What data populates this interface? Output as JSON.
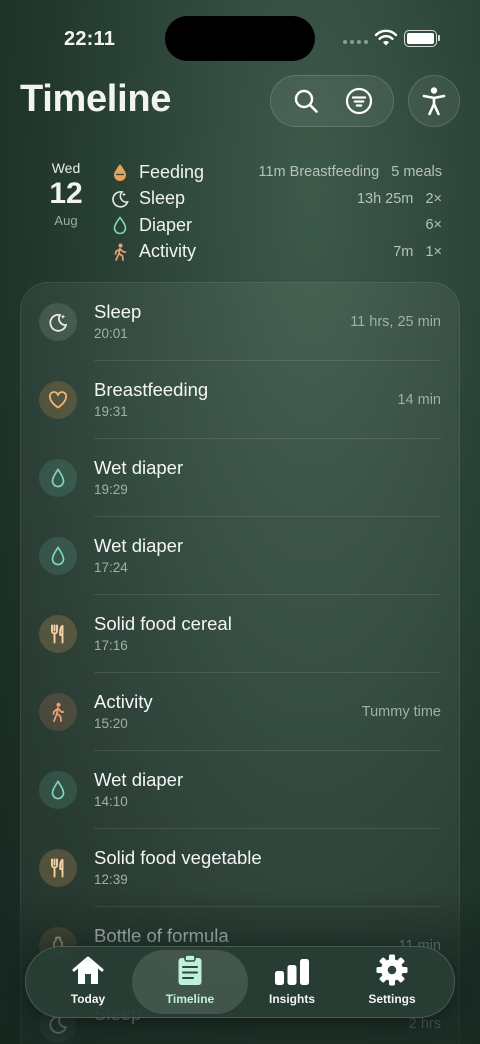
{
  "status_bar": {
    "time": "22:11"
  },
  "header": {
    "title": "Timeline"
  },
  "date": {
    "weekday": "Wed",
    "day": "12",
    "month": "Aug"
  },
  "summary": [
    {
      "label": "Feeding",
      "value": "11m Breastfeeding   5 meals",
      "icon": "drop-icon",
      "color": "#e5a25a"
    },
    {
      "label": "Sleep",
      "value": "13h 25m   2×",
      "icon": "moon-icon",
      "color": "#dfe5e1"
    },
    {
      "label": "Diaper",
      "value": "6×",
      "icon": "drop-outline-icon",
      "color": "#7fd6bf"
    },
    {
      "label": "Activity",
      "value": "7m   1×",
      "icon": "walking-icon",
      "color": "#e8a070"
    }
  ],
  "entries": [
    {
      "title": "Sleep",
      "time": "20:01",
      "value": "11 hrs, 25 min",
      "kind": "sleep"
    },
    {
      "title": "Breastfeeding",
      "time": "19:31",
      "value": "14 min",
      "kind": "feed"
    },
    {
      "title": "Wet diaper",
      "time": "19:29",
      "value": "",
      "kind": "diaper"
    },
    {
      "title": "Wet diaper",
      "time": "17:24",
      "value": "",
      "kind": "diaper"
    },
    {
      "title": "Solid food cereal",
      "time": "17:16",
      "value": "",
      "kind": "food"
    },
    {
      "title": "Activity",
      "time": "15:20",
      "value": "Tummy time",
      "kind": "activity"
    },
    {
      "title": "Wet diaper",
      "time": "14:10",
      "value": "",
      "kind": "diaper"
    },
    {
      "title": "Solid food vegetable",
      "time": "12:39",
      "value": "",
      "kind": "food"
    },
    {
      "title": "Bottle of formula",
      "time": "",
      "value": "11 min",
      "kind": "bottle"
    },
    {
      "title": "Sleep",
      "time": "",
      "value": "2 hrs",
      "kind": "sleep"
    }
  ],
  "tabs": [
    {
      "label": "Today",
      "icon": "house-icon",
      "active": false
    },
    {
      "label": "Timeline",
      "icon": "clipboard-icon",
      "active": true
    },
    {
      "label": "Insights",
      "icon": "bar-chart-icon",
      "active": false
    },
    {
      "label": "Settings",
      "icon": "gear-icon",
      "active": false
    }
  ],
  "colors": {
    "accent": "#bff0dc",
    "feeding": "#e5a25a",
    "diaper": "#7fd6bf",
    "activity": "#e8a070"
  }
}
